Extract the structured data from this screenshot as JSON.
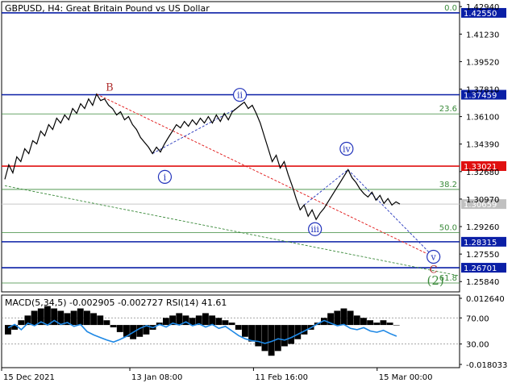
{
  "header": {
    "symbol": "GBPUSD, H4:",
    "description": "Great Britain Pound vs US Dollar"
  },
  "indicator_header": "MACD(5,34,5) -0.002905 -0.002727 RSI(14) 41.61",
  "colors": {
    "price": "#000000",
    "support_blue": "#0a1fa6",
    "resistance_red": "#e01010",
    "fib_green": "#3a8a3a",
    "wave_blue": "#2233bb",
    "label_red": "#b03030",
    "macd_line": "#1e88e5"
  },
  "chart_data": [
    {
      "type": "line",
      "title": "GBPUSD, H4",
      "price_axis_ticks": [
        "1.42940",
        "1.41230",
        "1.39520",
        "1.37810",
        "1.36100",
        "1.34390",
        "1.32680",
        "1.30970",
        "1.29260",
        "1.27550",
        "1.25840"
      ],
      "time_axis_ticks": [
        "15 Dec 2021",
        "13 Jan 08:00",
        "11 Feb 16:00",
        "15 Mar 00:00"
      ],
      "ylim": [
        1.252,
        1.4325
      ],
      "horizontal_levels": [
        {
          "label": "1.42550",
          "value": 1.4255,
          "kind": "blue"
        },
        {
          "label": "1.37459",
          "value": 1.37459,
          "kind": "blue"
        },
        {
          "label": "1.33021",
          "value": 1.33021,
          "kind": "red"
        },
        {
          "label": "1.30659",
          "value": 1.30659,
          "kind": "current"
        },
        {
          "label": "1.28315",
          "value": 1.28315,
          "kind": "blue"
        },
        {
          "label": "1.26701",
          "value": 1.26701,
          "kind": "blue"
        }
      ],
      "fib_levels": [
        {
          "label": "0.0",
          "value": 1.4255
        },
        {
          "label": "23.6",
          "value": 1.3627
        },
        {
          "label": "38.2",
          "value": 1.3157
        },
        {
          "label": "50.0",
          "value": 1.2888
        },
        {
          "label": "61.8",
          "value": 1.2575
        }
      ],
      "wave_labels": [
        {
          "text": "B",
          "t": 0.265,
          "value": 1.3795,
          "style": "plain-red"
        },
        {
          "text": "i",
          "t": 0.405,
          "value": 1.3235,
          "style": "circle"
        },
        {
          "text": "ii",
          "t": 0.595,
          "value": 1.3745,
          "style": "circle"
        },
        {
          "text": "iii",
          "t": 0.785,
          "value": 1.291,
          "style": "circle"
        },
        {
          "text": "iv",
          "t": 0.865,
          "value": 1.341,
          "style": "circle"
        },
        {
          "text": "v",
          "t": 1.085,
          "value": 1.2738,
          "style": "circle"
        },
        {
          "text": "C",
          "t": 1.085,
          "value": 1.2664,
          "style": "plain-red"
        },
        {
          "text": "(2)",
          "t": 1.09,
          "value": 1.259,
          "style": "plain-green"
        }
      ],
      "series": [
        {
          "values": [
            1.322,
            1.331,
            1.326,
            1.336,
            1.333,
            1.341,
            1.338,
            1.346,
            1.344,
            1.352,
            1.349,
            1.356,
            1.353,
            1.36,
            1.357,
            1.362,
            1.359,
            1.366,
            1.363,
            1.369,
            1.366,
            1.372,
            1.368,
            1.375,
            1.371,
            1.372,
            1.368,
            1.366,
            1.362,
            1.364,
            1.359,
            1.361,
            1.356,
            1.353,
            1.348,
            1.345,
            1.342,
            1.338,
            1.342,
            1.339,
            1.344,
            1.348,
            1.352,
            1.356,
            1.354,
            1.358,
            1.355,
            1.359,
            1.356,
            1.36,
            1.357,
            1.361,
            1.357,
            1.362,
            1.358,
            1.363,
            1.359,
            1.364,
            1.366,
            1.368,
            1.37,
            1.366,
            1.368,
            1.363,
            1.357,
            1.349,
            1.341,
            1.333,
            1.337,
            1.329,
            1.333,
            1.325,
            1.318,
            1.31,
            1.303,
            1.306,
            1.299,
            1.303,
            1.297,
            1.301,
            1.304,
            1.308,
            1.312,
            1.316,
            1.32,
            1.324,
            1.328,
            1.323,
            1.32,
            1.316,
            1.313,
            1.311,
            1.314,
            1.309,
            1.312,
            1.307,
            1.31,
            1.306,
            1.308,
            1.3066
          ]
        }
      ]
    },
    {
      "type": "bar",
      "title": "MACD(5,34,5) RSI(14)",
      "axis_ticks": [
        "0.012640",
        "70.00",
        "30.00",
        "-0.018033"
      ],
      "macd_histogram": [
        -0.004,
        -0.002,
        0.002,
        0.004,
        0.006,
        0.007,
        0.008,
        0.007,
        0.006,
        0.005,
        0.006,
        0.007,
        0.006,
        0.005,
        0.004,
        0.002,
        -0.001,
        -0.003,
        -0.005,
        -0.006,
        -0.005,
        -0.004,
        -0.002,
        0.001,
        0.003,
        0.004,
        0.005,
        0.004,
        0.003,
        0.004,
        0.005,
        0.004,
        0.003,
        0.002,
        0.001,
        -0.002,
        -0.005,
        -0.007,
        -0.009,
        -0.011,
        -0.013,
        -0.011,
        -0.009,
        -0.008,
        -0.006,
        -0.004,
        -0.002,
        0.001,
        0.003,
        0.005,
        0.006,
        0.007,
        0.006,
        0.004,
        0.003,
        0.002,
        0.001,
        0.002,
        0.001,
        0.0
      ],
      "rsi_values": [
        55,
        60,
        52,
        62,
        58,
        64,
        59,
        66,
        60,
        63,
        57,
        60,
        49,
        44,
        40,
        36,
        33,
        37,
        42,
        48,
        54,
        58,
        55,
        60,
        56,
        62,
        59,
        64,
        58,
        61,
        56,
        60,
        54,
        57,
        50,
        43,
        38,
        35,
        34,
        31,
        34,
        38,
        36,
        40,
        45,
        50,
        55,
        61,
        66,
        62,
        58,
        60,
        54,
        52,
        55,
        50,
        48,
        51,
        46,
        42
      ]
    }
  ]
}
